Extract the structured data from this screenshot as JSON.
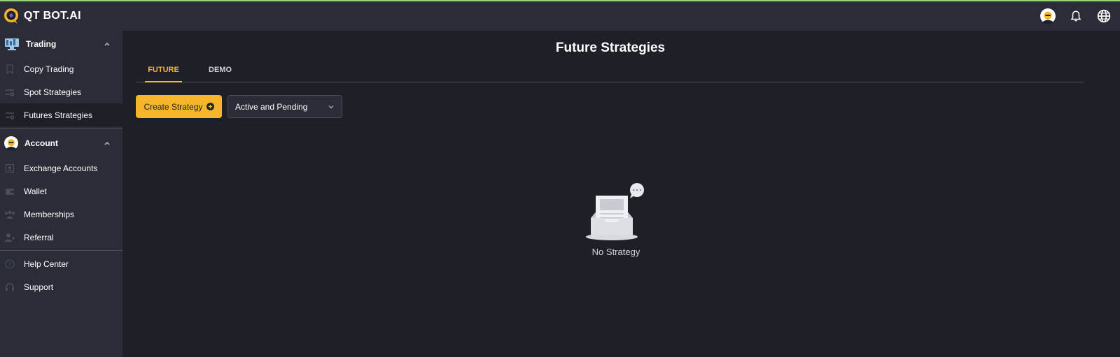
{
  "app": {
    "brand": "QT BOT.AI",
    "accent": "#f7b52c"
  },
  "header": {
    "icons": [
      "user-avatar",
      "bell-icon",
      "globe-icon"
    ]
  },
  "sidebar": {
    "trading": {
      "label": "Trading",
      "items": [
        {
          "label": "Copy Trading",
          "icon": "bookmark-icon"
        },
        {
          "label": "Spot Strategies",
          "icon": "strategy-list-icon"
        },
        {
          "label": "Futures Strategies",
          "icon": "strategy-list-icon",
          "active": true
        }
      ]
    },
    "account": {
      "label": "Account",
      "items": [
        {
          "label": "Exchange Accounts",
          "icon": "exchange-icon"
        },
        {
          "label": "Wallet",
          "icon": "wallet-icon"
        },
        {
          "label": "Memberships",
          "icon": "members-icon"
        },
        {
          "label": "Referral",
          "icon": "referral-icon"
        }
      ]
    },
    "footer": [
      {
        "label": "Help Center",
        "icon": "help-icon"
      },
      {
        "label": "Support",
        "icon": "headset-icon"
      }
    ]
  },
  "main": {
    "title": "Future Strategies",
    "tabs": [
      {
        "label": "FUTURE",
        "active": true
      },
      {
        "label": "DEMO",
        "active": false
      }
    ],
    "create_button": "Create Strategy",
    "filter": {
      "selected": "Active and Pending"
    },
    "empty_state": "No Strategy"
  }
}
